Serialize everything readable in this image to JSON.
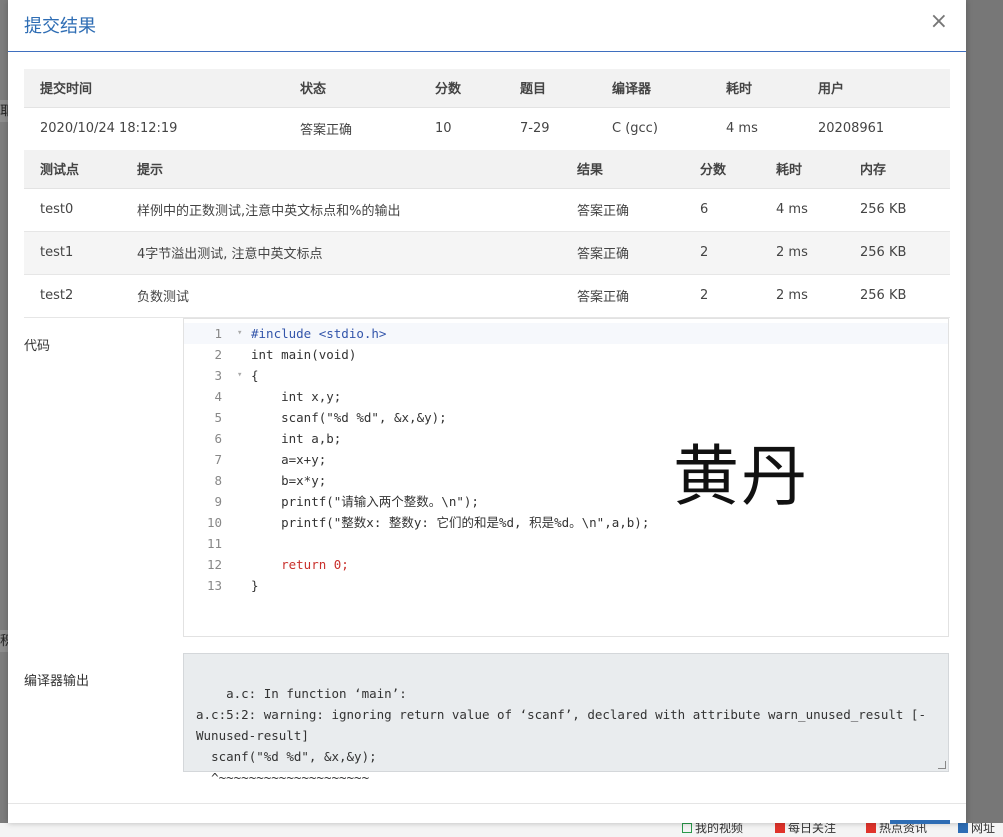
{
  "modal": {
    "title": "提交结果",
    "close": "×"
  },
  "summary": {
    "headers": [
      "提交时间",
      "状态",
      "分数",
      "题目",
      "编译器",
      "耗时",
      "用户"
    ],
    "row": {
      "time": "2020/10/24 18:12:19",
      "status": "答案正确",
      "score": "10",
      "problem": "7-29",
      "compiler": "C (gcc)",
      "elapsed": "4 ms",
      "user": "20208961"
    }
  },
  "tests": {
    "headers": [
      "测试点",
      "提示",
      "结果",
      "分数",
      "耗时",
      "内存"
    ],
    "rows": [
      {
        "name": "test0",
        "hint": "样例中的正数测试,注意中英文标点和%的输出",
        "result": "答案正确",
        "score": "6",
        "time": "4 ms",
        "mem": "256 KB"
      },
      {
        "name": "test1",
        "hint": "4字节溢出测试, 注意中英文标点",
        "result": "答案正确",
        "score": "2",
        "time": "2 ms",
        "mem": "256 KB"
      },
      {
        "name": "test2",
        "hint": "负数测试",
        "result": "答案正确",
        "score": "2",
        "time": "2 ms",
        "mem": "256 KB"
      }
    ]
  },
  "code": {
    "label": "代码",
    "lines": [
      "#include <stdio.h>",
      "int main(void)",
      "{",
      "    int x,y;",
      "    scanf(\"%d %d\", &x,&y);",
      "    int a,b;",
      "    a=x+y;",
      "    b=x*y;",
      "    printf(\"请输入两个整数。\\n\");",
      "    printf(\"整数x: 整数y: 它们的和是%d, 积是%d。\\n\",a,b);",
      "",
      "    return 0;",
      "}"
    ]
  },
  "watermark": "黄丹",
  "compiler_output": {
    "label": "编译器输出",
    "text": "a.c: In function ‘main’:\na.c:5:2: warning: ignoring return value of ‘scanf’, declared with attribute warn_unused_result [-Wunused-result]\n  scanf(\"%d %d\", &x,&y);\n  ^~~~~~~~~~~~~~~~~~~~~"
  },
  "background": {
    "bottom_links": [
      "我的视频",
      "每日关注",
      "热点资讯",
      "网址"
    ]
  }
}
